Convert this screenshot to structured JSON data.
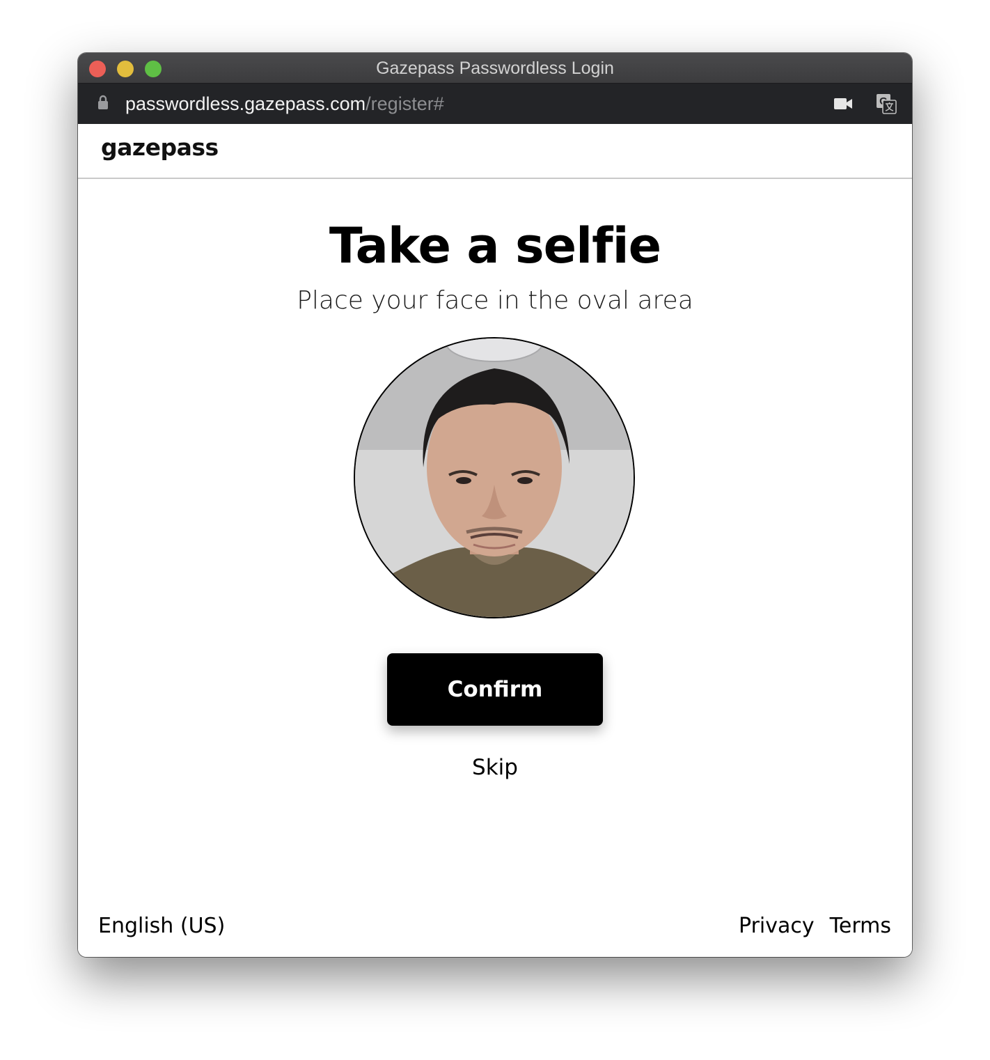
{
  "window": {
    "title": "Gazepass Passwordless Login"
  },
  "address_bar": {
    "host": "passwordless.gazepass.com",
    "path": "/register#"
  },
  "header": {
    "logo_text": "gazepass"
  },
  "main": {
    "title": "Take a selfie",
    "subtitle": "Place your face in the oval area",
    "confirm_label": "Confirm",
    "skip_label": "Skip"
  },
  "footer": {
    "language": "English (US)",
    "privacy_label": "Privacy",
    "terms_label": "Terms"
  },
  "icons": {
    "lock": "lock-icon",
    "camera": "camera-icon",
    "translate": "translate-icon"
  },
  "colors": {
    "button_bg": "#000000",
    "button_text": "#ffffff",
    "titlebar_bg": "#3c3c3e",
    "urlbar_bg": "#232427",
    "close": "#ec5f57",
    "minimize": "#e2bd3d",
    "maximize": "#5fbf45"
  }
}
